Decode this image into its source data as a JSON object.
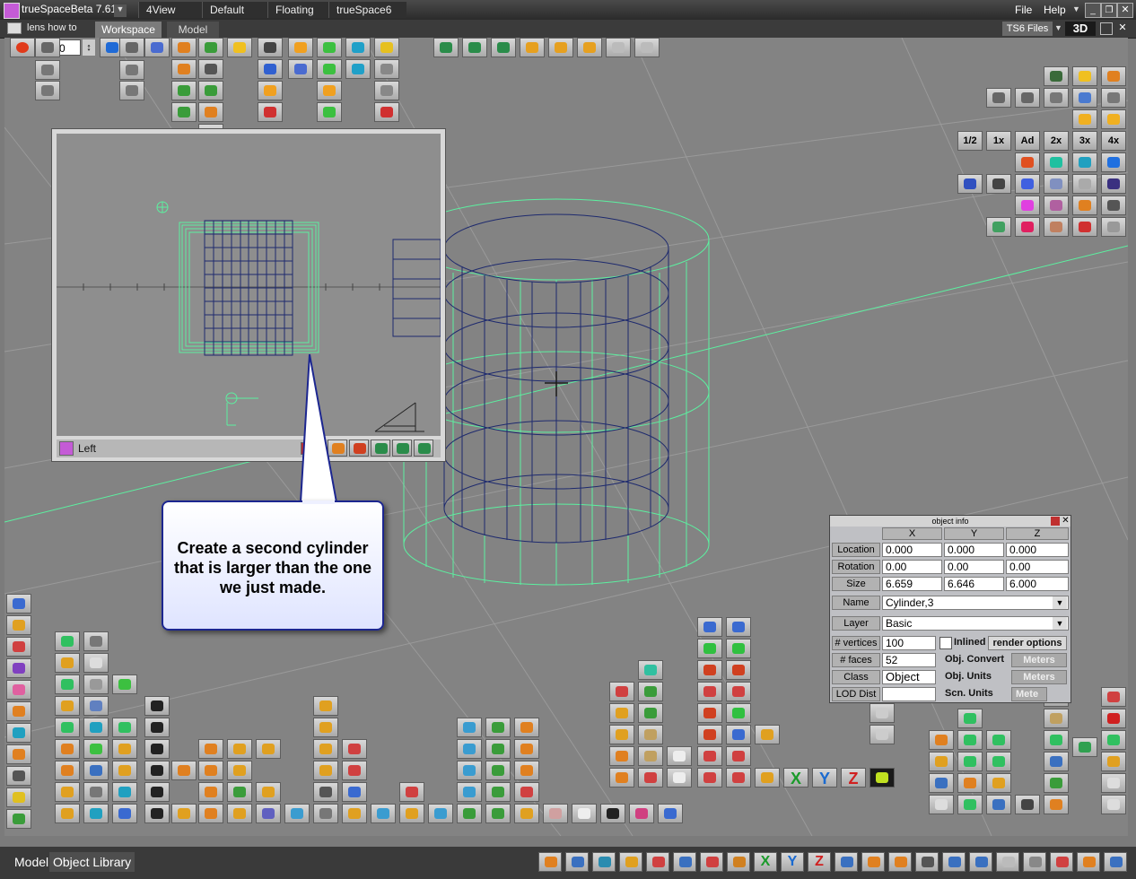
{
  "app": {
    "title": "trueSpaceBeta 7.61",
    "menu_file": "File",
    "menu_help": "Help"
  },
  "title_tabs": [
    "4View",
    "Default",
    "Floating",
    "trueSpace6"
  ],
  "workspace_bar": {
    "project": "lens how to",
    "tabs": [
      "Workspace",
      "Model"
    ],
    "ts6_files": "TS6 Files",
    "view_mode": "3D"
  },
  "frame_field": {
    "value": "0"
  },
  "left_view": {
    "label": "Left"
  },
  "callout": {
    "text": "Create a second cylinder that is larger than the one we just made."
  },
  "object_info": {
    "title": "object info",
    "columns": [
      "X",
      "Y",
      "Z"
    ],
    "rows": [
      {
        "label": "Location",
        "values": [
          "0.000",
          "0.000",
          "0.000"
        ]
      },
      {
        "label": "Rotation",
        "values": [
          "0.00",
          "0.00",
          "0.00"
        ]
      },
      {
        "label": "Size",
        "values": [
          "6.659",
          "6.646",
          "6.000"
        ]
      }
    ],
    "name_label": "Name",
    "name_value": "Cylinder,3",
    "layer_label": "Layer",
    "layer_value": "Basic",
    "vertices_label": "# vertices",
    "vertices_value": "100",
    "faces_label": "# faces",
    "faces_value": "52",
    "class_label": "Class",
    "class_value": "Object",
    "lod_label": "LOD Dist",
    "inlined_label": "Inlined",
    "render_options": "render options",
    "obj_convert": "Obj. Convert",
    "obj_units": "Obj. Units",
    "scn_units": "Scn. Units",
    "units_value": "Meters",
    "units_partial": "Mete"
  },
  "zoom_buttons": [
    "1/2",
    "1x",
    "Ad",
    "2x",
    "3x",
    "4x"
  ],
  "axis_buttons": [
    "X",
    "Y",
    "Z"
  ],
  "bottom_tabs": [
    "Model",
    "Object Library"
  ],
  "colors": {
    "wire_green": "#5cf0a0",
    "wire_navy": "#1e2a6e",
    "callout_border": "#1c2690"
  }
}
